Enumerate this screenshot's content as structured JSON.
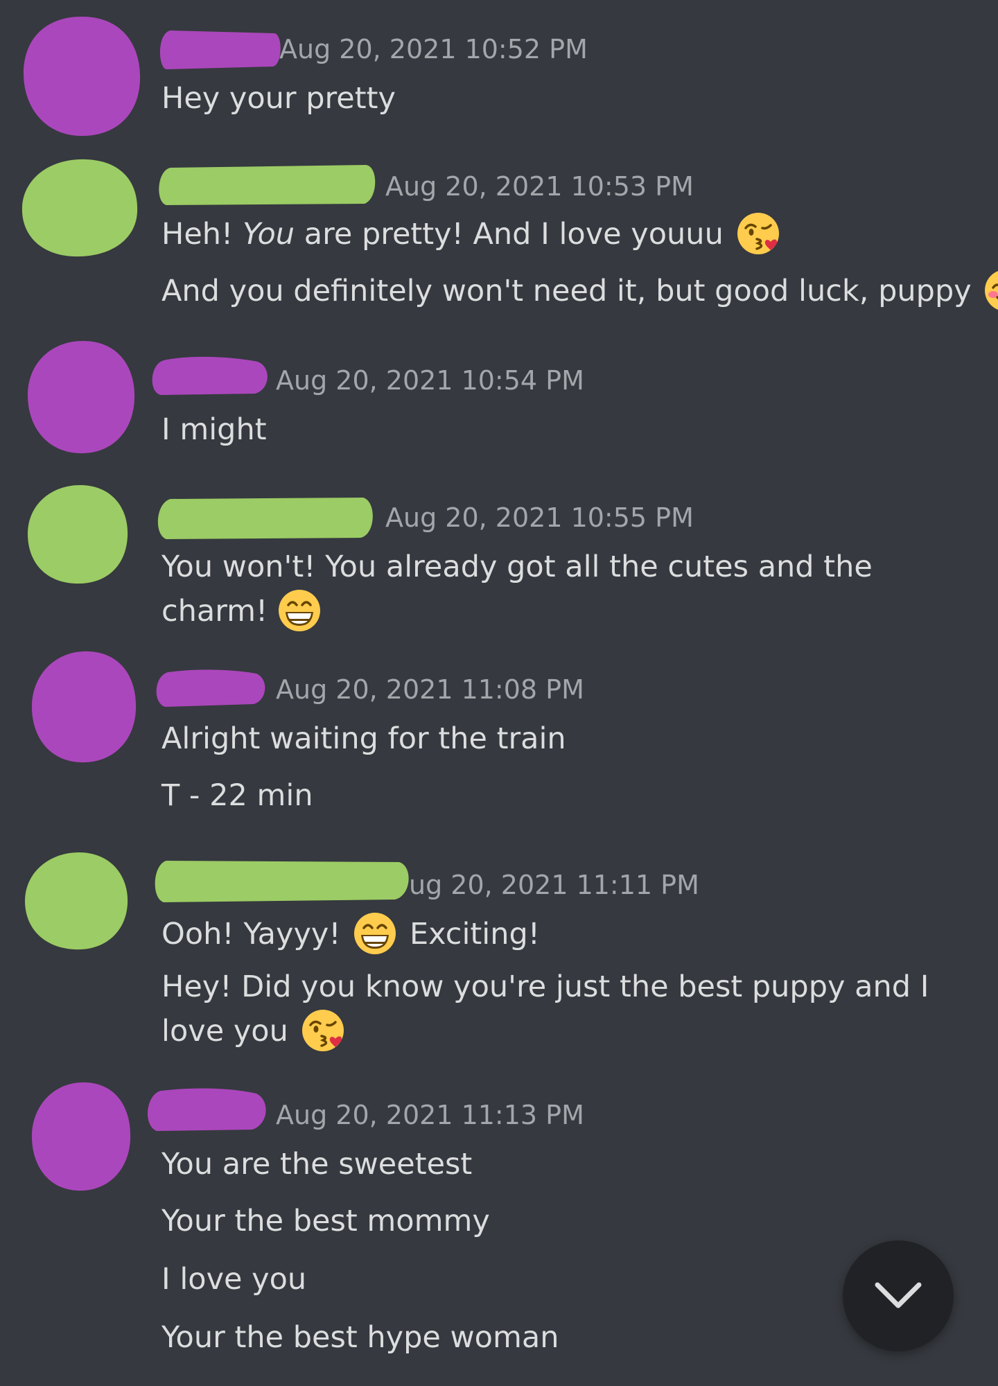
{
  "colors": {
    "background": "#36393f",
    "timestamp": "#a3a6aa",
    "message_text": "#dcddde",
    "user_a_redaction": "#ab47bc",
    "user_b_redaction": "#9ccc65",
    "scroll_button": "#202225"
  },
  "messages": [
    {
      "user": "user_a",
      "timestamp": "Aug 20, 2021 10:52 PM",
      "lines": [
        "Hey your pretty"
      ]
    },
    {
      "user": "user_b",
      "timestamp": "Aug 20, 2021 10:53 PM",
      "lines": [
        {
          "prefix": "Heh! ",
          "emphasis": "You",
          "text": " are pretty! And I love youuu",
          "emoji": "kissing-heart-emoji"
        },
        {
          "text": "And you definitely won't need it, but good luck, puppy",
          "emoji": "smiling-blush-emoji"
        }
      ]
    },
    {
      "user": "user_a",
      "timestamp": "Aug 20, 2021 10:54 PM",
      "lines": [
        "I might"
      ]
    },
    {
      "user": "user_b",
      "timestamp": "Aug 20, 2021 10:55 PM",
      "lines": [
        {
          "text": "You won't! You already got all the cutes and the charm!",
          "emoji": "grinning-emoji"
        }
      ]
    },
    {
      "user": "user_a",
      "timestamp": "Aug 20, 2021 11:08 PM",
      "lines": [
        "Alright waiting for the train",
        "T - 22 min"
      ]
    },
    {
      "user": "user_b",
      "timestamp": "ug 20, 2021 11:11 PM",
      "lines": [
        {
          "text": "Ooh! Yayyy!",
          "emoji": "grinning-emoji",
          "after": "Exciting!"
        },
        {
          "text": "Hey! Did you know you're just the best puppy and I love you",
          "emoji": "kissing-heart-emoji"
        }
      ]
    },
    {
      "user": "user_a",
      "timestamp": "Aug 20, 2021 11:13 PM",
      "lines": [
        "You are the sweetest",
        "Your the best mommy",
        "I love you",
        "Your the best hype woman"
      ]
    }
  ],
  "scroll_button": {
    "icon": "chevron-down-icon"
  }
}
